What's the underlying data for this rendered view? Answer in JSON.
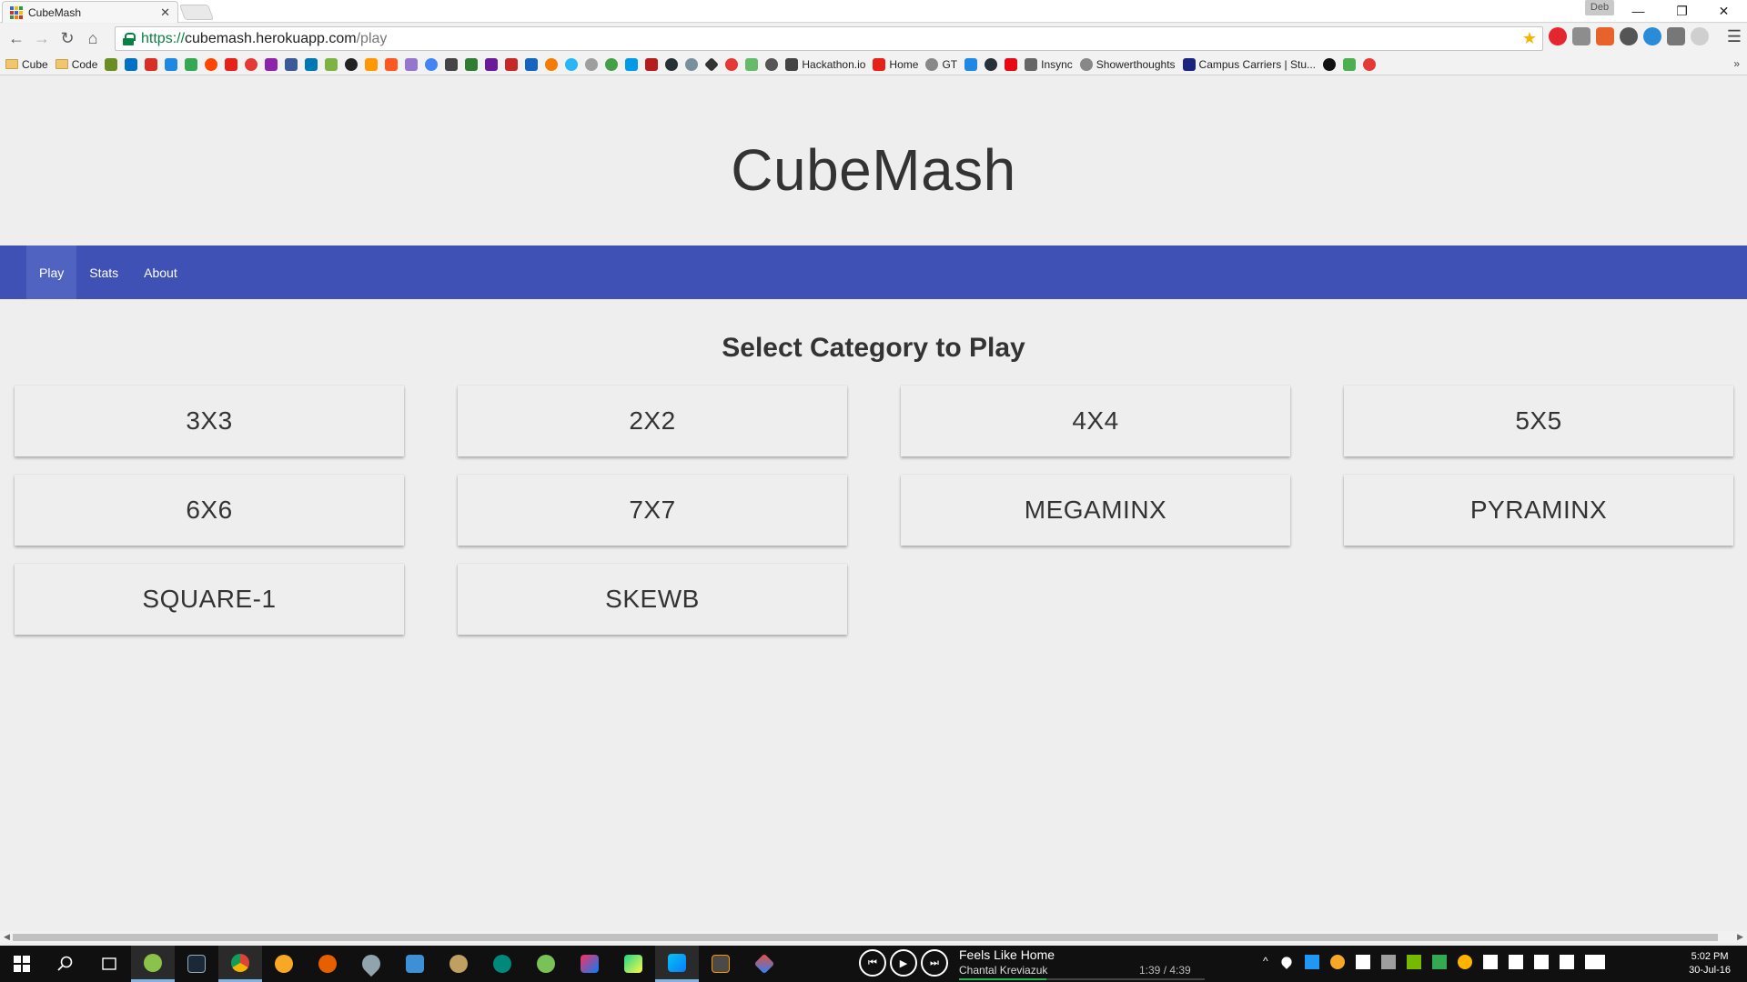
{
  "browser": {
    "tab_title": "CubeMash",
    "profile_name": "Deb",
    "url_scheme": "https://",
    "url_host": "cubemash.herokuapp.com",
    "url_path": "/play",
    "bookmarks": {
      "folder1": "Cube",
      "folder2": "Code",
      "hackathon": "Hackathon.io",
      "home": "Home",
      "gt": "GT",
      "insync": "Insync",
      "showerthoughts": "Showerthoughts",
      "campus": "Campus Carriers | Stu..."
    }
  },
  "site": {
    "title": "CubeMash",
    "nav": [
      "Play",
      "Stats",
      "About"
    ],
    "active_nav": "Play",
    "subtitle": "Select Category to Play",
    "categories": [
      "3X3",
      "2X2",
      "4X4",
      "5X5",
      "6X6",
      "7X7",
      "MEGAMINX",
      "PYRAMINX",
      "SQUARE-1",
      "SKEWB"
    ],
    "accent_color": "#3f51b5"
  },
  "taskbar": {
    "song_title": "Feels Like Home",
    "song_artist": "Chantal Kreviazuk",
    "song_time": "1:39 / 4:39",
    "song_progress": 0.355,
    "time": "5:02 PM",
    "date": "30-Jul-16"
  }
}
